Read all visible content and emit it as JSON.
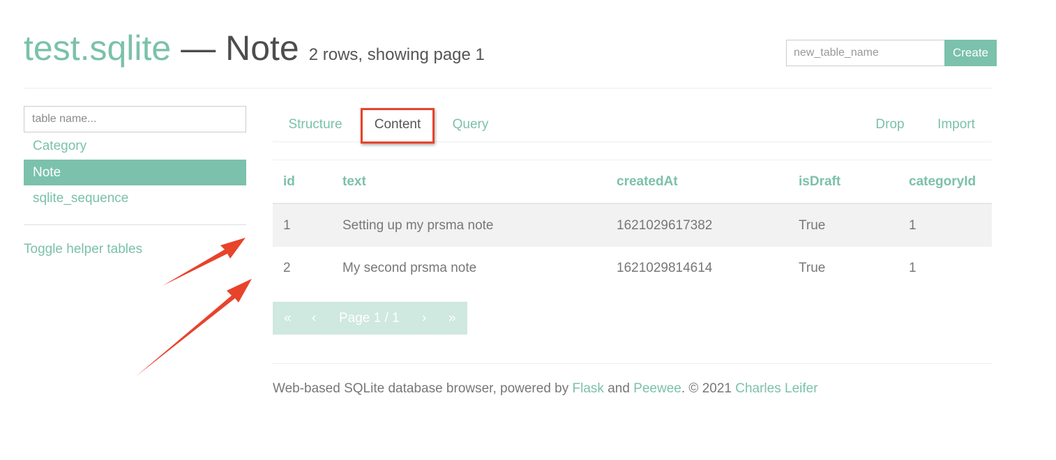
{
  "header": {
    "db_name": "test.sqlite",
    "table_title": "— Note",
    "rows_info": "2 rows, showing page 1"
  },
  "create": {
    "placeholder": "new_table_name",
    "button_label": "Create"
  },
  "sidebar": {
    "filter_placeholder": "table name...",
    "items": [
      {
        "label": "Category"
      },
      {
        "label": "Note"
      },
      {
        "label": "sqlite_sequence"
      }
    ],
    "toggle_helper": "Toggle helper tables"
  },
  "tabs": {
    "structure": "Structure",
    "content": "Content",
    "query": "Query",
    "drop": "Drop",
    "import": "Import"
  },
  "table": {
    "columns": [
      "id",
      "text",
      "createdAt",
      "isDraft",
      "categoryId"
    ],
    "rows": [
      [
        "1",
        "Setting up my prsma note",
        "1621029617382",
        "True",
        "1"
      ],
      [
        "2",
        "My second prsma note",
        "1621029814614",
        "True",
        "1"
      ]
    ]
  },
  "pager": {
    "first": "«",
    "prev": "‹",
    "label": "Page 1 / 1",
    "next": "›",
    "last": "»"
  },
  "footer": {
    "prefix": "Web-based SQLite database browser, powered by ",
    "flask": "Flask",
    "and": " and ",
    "peewee": "Peewee",
    "copyright": ". © 2021 ",
    "author": "Charles Leifer"
  },
  "colors": {
    "accent": "#7bc1ab",
    "annotation": "#e8432b"
  }
}
